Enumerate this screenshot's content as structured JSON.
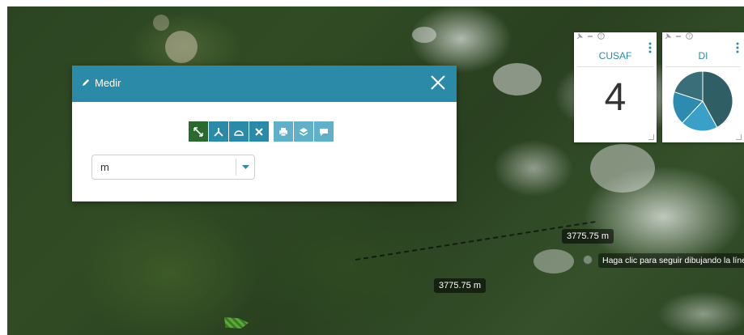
{
  "dialog": {
    "title": "Medir",
    "close_icon": "close-icon",
    "unit_value": "m"
  },
  "toolbar": {
    "tools": [
      "measure-line-icon",
      "measure-angle-icon",
      "measure-area-icon",
      "clear-icon",
      "print-icon",
      "layers-icon",
      "comment-icon"
    ],
    "active_tool": "measure-line-icon"
  },
  "widgets": {
    "cusaf": {
      "title": "CUSAF",
      "value": "4"
    },
    "di": {
      "title": "DI",
      "pie": {
        "slices": [
          {
            "value": 0.42,
            "color": "#2f5f64"
          },
          {
            "value": 0.2,
            "color": "#3aa0c8"
          },
          {
            "value": 0.18,
            "color": "#2d8bb0"
          },
          {
            "value": 0.2,
            "color": "#3a6e78"
          }
        ]
      }
    }
  },
  "map": {
    "measure_label_1": "3775.75 m",
    "measure_label_2": "3775.75 m",
    "hint": "Haga clic para seguir dibujando la línea"
  },
  "colors": {
    "accent": "#2b8aa8",
    "active_tool": "#2a6a2f",
    "light_tool": "#5fb0c8"
  }
}
